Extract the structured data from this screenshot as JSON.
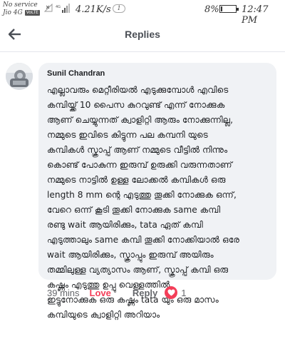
{
  "status_bar": {
    "carrier_line1": "No service",
    "carrier_line2": "Jio 4G",
    "volte": "VoLTE",
    "network_speed": "4.21K/s",
    "notification_count": "1",
    "battery_percent": "8%",
    "battery_level": 0.08,
    "time": "12:47 PM"
  },
  "header": {
    "title": "Replies",
    "back_icon": "arrow-left-icon"
  },
  "comment": {
    "author": "Sunil Chandran",
    "lines": [
      "എല്ലാവരും മെറ്റീരിയൽ എടുക്കുമ്പോൾ എവിടെ",
      "കമ്പിയ്ക്ക് 10 പൈസ കുറവുണ്ട് എന്ന് നോക്കുക",
      "ആണ് ചെയ്യുന്നത് ക്വാളിറ്റി ആരും നോക്കുന്നില്ല,",
      "നമ്മുടെ ഇവിടെ കിട്ടുന്ന പല കമ്പനി യുടെ",
      "കമ്പികൾ സ്ക്രാപ്പ് ആണ് നമ്മുടെ വീട്ടിൽ നിന്നും",
      "കൊണ്ട് പോകുന്ന ഇരുമ്പ് ഉരുക്കി വരുന്നതാണ്",
      "നമ്മുടെ നാട്ടിൽ ഉള്ള ലോക്കൽ കമ്പികൾ ഒരു",
      "length 8 mm ന്റെ എടുത്തു തൂക്കി നോക്കുക ഒന്ന്,",
      "വേറെ ഒന്ന് കൂടി തൂക്കി നോക്കുക same കമ്പി",
      "രണ്ടു wait ആയിരിക്കും, tata ഏത് കമ്പി",
      "എടുത്താലും same കമ്പി തൂക്കി നോക്കിയാൽ ഒരേ",
      "wait ആയിരിക്കും, സ്ക്രാപ്പും ഇരുമ്പ് അയിരും",
      "തമ്മിലുള്ള വ്യത്യാസം ആണ്, സ്ക്രാപ്പ് കമ്പി ഒരു",
      "കഷ്ണം എടുത്തു ഉപ്പു വെള്ളത്തിൽ",
      "ഇട്ടുനോക്കുക ഒരു കഷ്ണം tata യും ഒരു മാസം",
      "കമ്പിയുടെ ക്വാളിറ്റി അറിയാം"
    ],
    "time": "39 mins",
    "love_label": "Love",
    "reply_label": "Reply",
    "reaction_icon": "heart-icon",
    "reaction_count": "1",
    "accent_color": "#f33e58"
  }
}
